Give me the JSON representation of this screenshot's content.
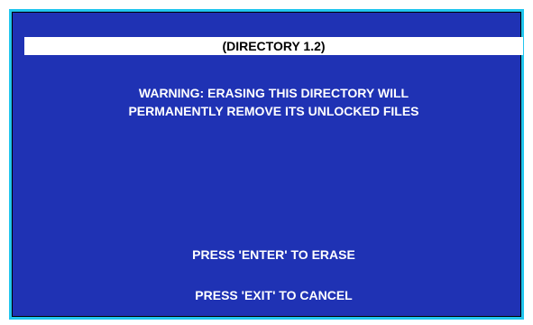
{
  "screen": {
    "title": "(DIRECTORY 1.2)",
    "warning_line_1": "WARNING:  ERASING THIS DIRECTORY WILL",
    "warning_line_2": "PERMANENTLY REMOVE ITS UNLOCKED FILES",
    "enter_prompt": "PRESS 'ENTER' TO ERASE",
    "exit_prompt": "PRESS 'EXIT' TO CANCEL"
  },
  "colors": {
    "background": "#1f32b4",
    "frame": "#22c6ee",
    "title_bar": "#ffffff",
    "text": "#ffffff"
  }
}
